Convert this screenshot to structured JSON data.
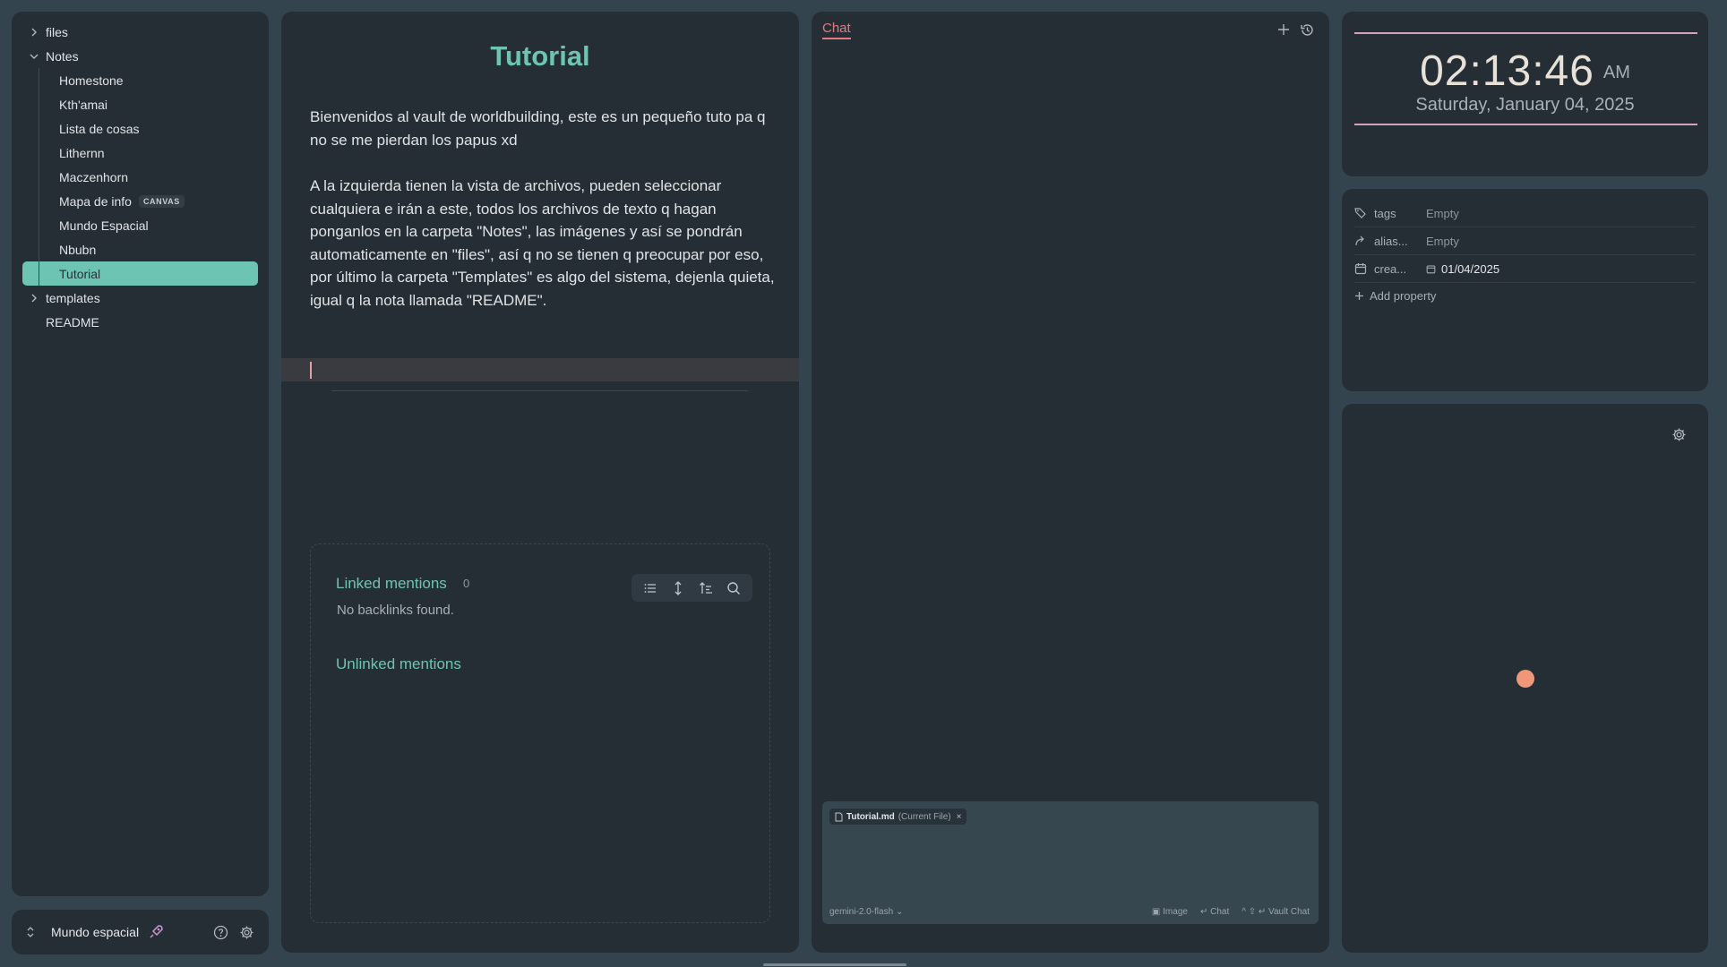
{
  "sidebar": {
    "items": [
      {
        "label": "files",
        "chevron": "right",
        "level": 0
      },
      {
        "label": "Notes",
        "chevron": "down",
        "level": 0
      },
      {
        "label": "Homestone",
        "level": 1
      },
      {
        "label": "Kth'amai",
        "level": 1
      },
      {
        "label": "Lista de cosas",
        "level": 1
      },
      {
        "label": "Lithernn",
        "level": 1
      },
      {
        "label": "Maczenhorn",
        "level": 1
      },
      {
        "label": "Mapa de info",
        "level": 1,
        "badge": "CANVAS"
      },
      {
        "label": "Mundo Espacial",
        "level": 1
      },
      {
        "label": "Nbubn",
        "level": 1
      },
      {
        "label": "Tutorial",
        "level": 1,
        "active": true
      },
      {
        "label": "templates",
        "chevron": "right",
        "level": 0
      },
      {
        "label": "README",
        "level": 0
      }
    ]
  },
  "vault": {
    "name": "Mundo espacial",
    "icons": [
      "updown-icon",
      "rocket-icon",
      "help-icon",
      "gear-icon"
    ]
  },
  "editor": {
    "title": "Tutorial",
    "paragraphs": [
      "Bienvenidos al vault de worldbuilding, este es un pequeño tuto pa q no se me pierdan los papus xd",
      "A la izquierda tienen la vista de archivos, pueden seleccionar cualquiera e irán a este, todos los archivos de texto q hagan ponganlos en la carpeta \"Notes\", las imágenes y así se pondrán automaticamente en \"files\", así q no se tienen q preocupar por eso, por último la carpeta \"Templates\" es algo del sistema, dejenla quieta, igual q la nota llamada \"README\"."
    ],
    "backlinks": {
      "linked_title": "Linked mentions",
      "linked_count": "0",
      "no_backlinks": "No backlinks found.",
      "unlinked_title": "Unlinked mentions",
      "toolbar_icons": [
        "list-icon",
        "expand-icon",
        "sort-icon",
        "search-icon"
      ]
    }
  },
  "chat": {
    "tab_label": "Chat",
    "actions": [
      "plus-icon",
      "history-icon"
    ],
    "file_chip": {
      "name": "Tutorial.md",
      "note": "(Current File)",
      "remove": "×"
    },
    "model": "gemini-2.0-flash",
    "image_label": "Image",
    "chat_label": "Chat",
    "vault_chat_label": "Vault Chat"
  },
  "clock": {
    "time": "02:13:46",
    "ampm": "AM",
    "date": "Saturday, January 04, 2025",
    "accent": "#d9a0bc"
  },
  "properties": {
    "rows": [
      {
        "icon": "tags-icon",
        "name": "tags",
        "value": "Empty"
      },
      {
        "icon": "alias-icon",
        "name": "alias...",
        "value": "Empty"
      },
      {
        "icon": "calendar-icon",
        "name": "crea...",
        "value": "01/04/2025"
      }
    ],
    "add_label": "Add property"
  },
  "colors": {
    "accent_teal": "#6ec4b3",
    "chat_accent": "#e27a84",
    "dot": "#f0977a"
  }
}
